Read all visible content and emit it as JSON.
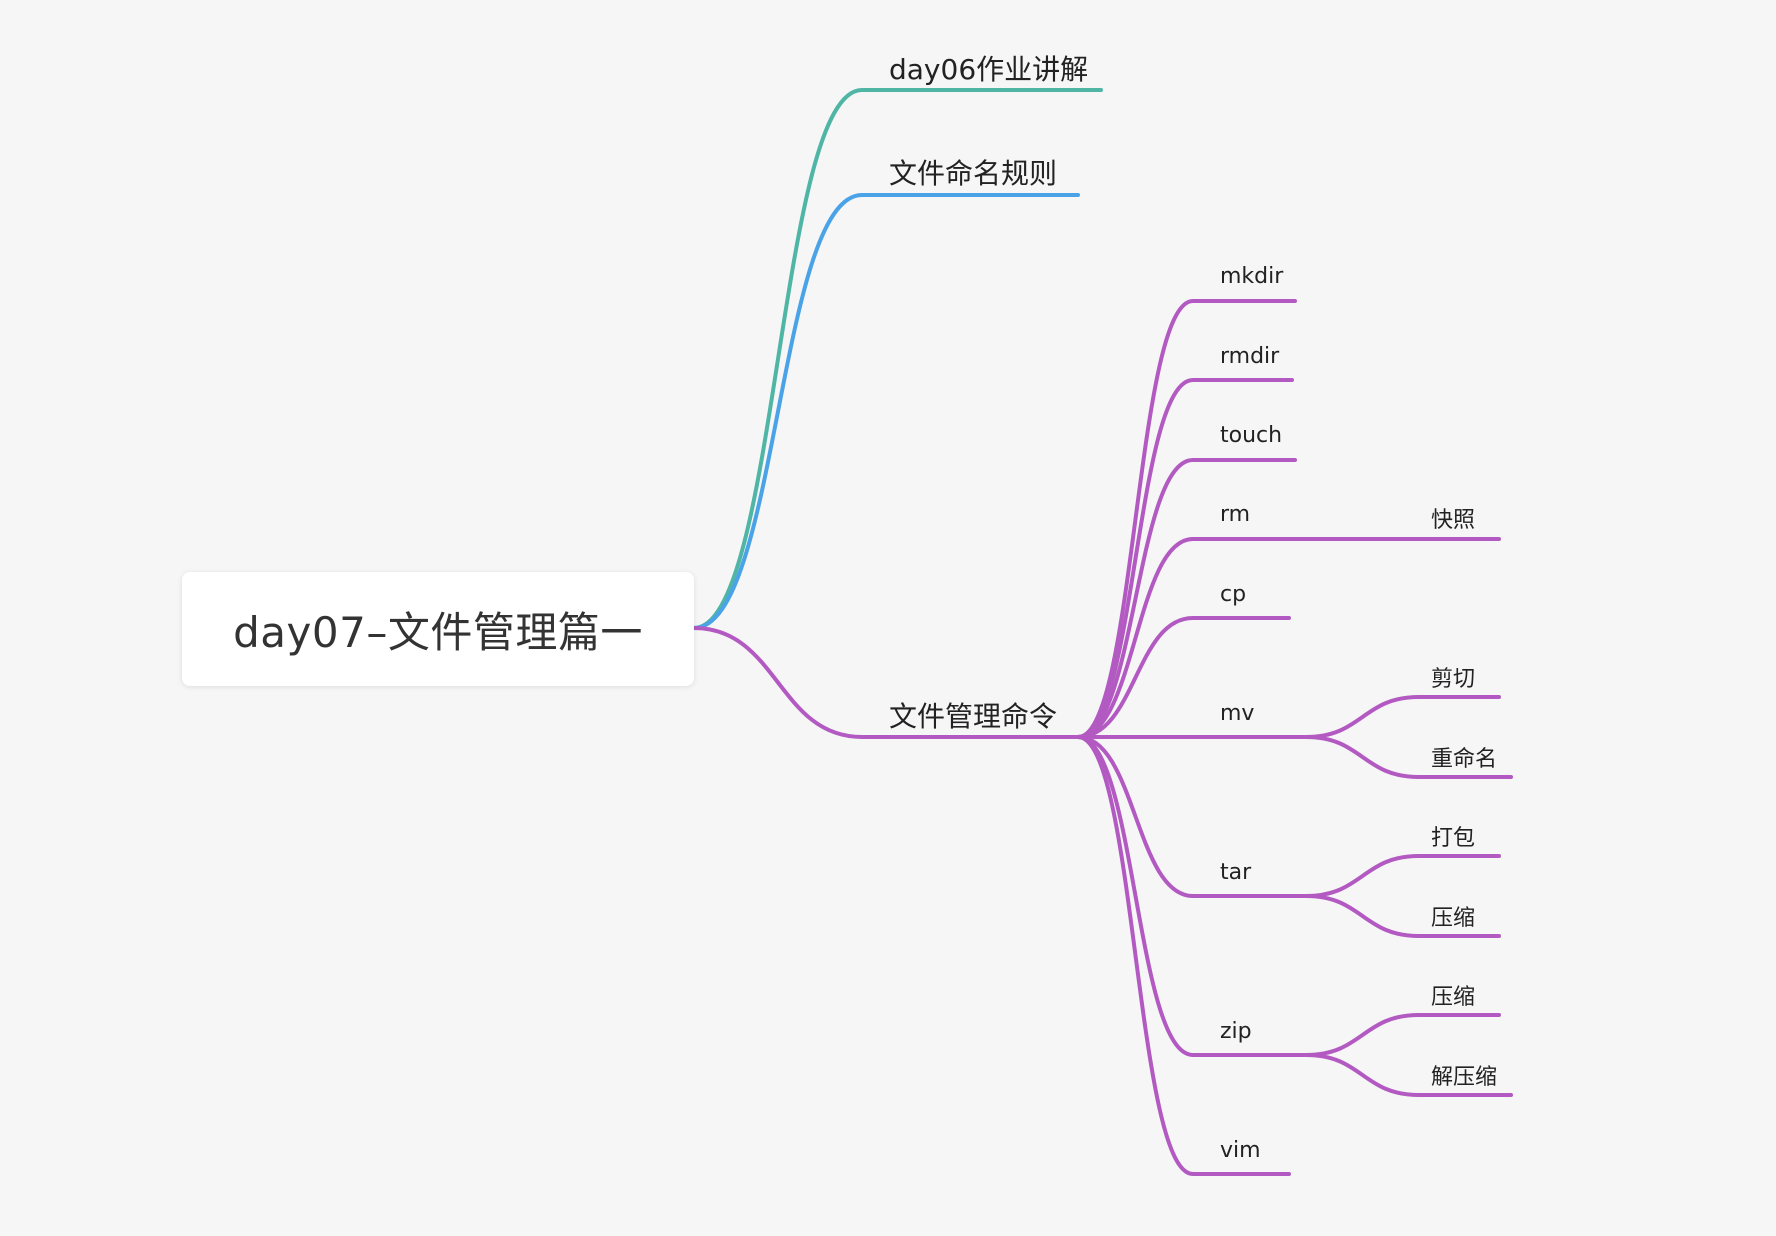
{
  "root": {
    "label": "day07–文件管理篇一"
  },
  "colors": {
    "teal": "#4fb5a5",
    "blue": "#4aa3e6",
    "purple": "#b35ac2"
  },
  "branches": [
    {
      "label": "day06作业讲解",
      "color": "teal",
      "children": []
    },
    {
      "label": "文件命名规则",
      "color": "blue",
      "children": []
    },
    {
      "label": "文件管理命令",
      "color": "purple",
      "children": [
        {
          "label": "mkdir",
          "children": []
        },
        {
          "label": "rmdir",
          "children": []
        },
        {
          "label": "touch",
          "children": []
        },
        {
          "label": "rm",
          "children": [
            {
              "label": "快照"
            }
          ]
        },
        {
          "label": "cp",
          "children": []
        },
        {
          "label": "mv",
          "children": [
            {
              "label": "剪切"
            },
            {
              "label": "重命名"
            }
          ]
        },
        {
          "label": "tar",
          "children": [
            {
              "label": "打包"
            },
            {
              "label": "压缩"
            }
          ]
        },
        {
          "label": "zip",
          "children": [
            {
              "label": "压缩"
            },
            {
              "label": "解压缩"
            }
          ]
        },
        {
          "label": "vim",
          "children": []
        }
      ]
    }
  ]
}
